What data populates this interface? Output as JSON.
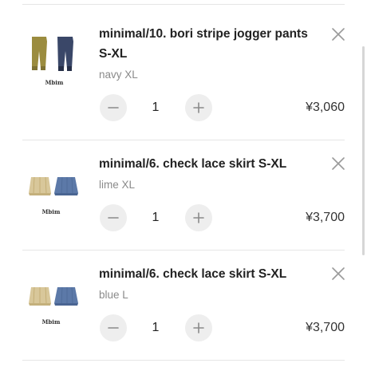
{
  "cart": {
    "items": [
      {
        "title": "minimal/10. bori stripe jogger pants S-XL",
        "variant": "navy XL",
        "quantity": "1",
        "price": "¥3,060",
        "thumb_caption": "Mbim",
        "thumb_icon": "jogger-pants-thumbnail",
        "colors": [
          "#9b8c3f",
          "#3a4768"
        ]
      },
      {
        "title": "minimal/6. check lace skirt S-XL",
        "variant": "lime XL",
        "quantity": "1",
        "price": "¥3,700",
        "thumb_caption": "Mbim",
        "thumb_icon": "lace-skirt-thumbnail",
        "colors": [
          "#d8c79a",
          "#5c79a8"
        ]
      },
      {
        "title": "minimal/6. check lace skirt S-XL",
        "variant": "blue L",
        "quantity": "1",
        "price": "¥3,700",
        "thumb_caption": "Mbim",
        "thumb_icon": "lace-skirt-thumbnail",
        "colors": [
          "#d8c79a",
          "#5c79a8"
        ]
      }
    ]
  },
  "icons": {
    "remove": "close-icon",
    "decrease": "minus-icon",
    "increase": "plus-icon"
  }
}
